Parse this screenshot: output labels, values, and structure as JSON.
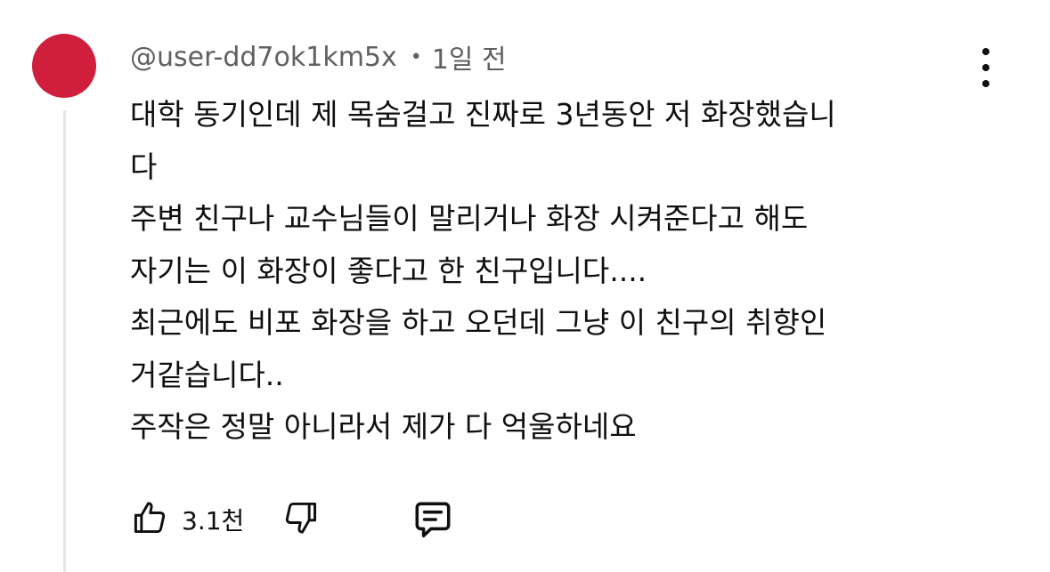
{
  "comment": {
    "author": "@user-dd7ok1km5x",
    "separator": "•",
    "timestamp": "1일 전",
    "avatar_color": "#d01e3d",
    "lines": [
      "대학 동기인데 제 목숨걸고 진짜로 3년동안 저 화장했습니",
      "다",
      "주변 친구나 교수님들이 말리거나 화장 시켜준다고 해도",
      "자기는 이 화장이 좋다고 한 친구입니다....",
      "최근에도 비포 화장을 하고 오던데 그냥 이 친구의 취향인",
      "거같습니다..",
      "주작은 정말 아니라서 제가 다 억울하네요"
    ]
  },
  "actions": {
    "like_icon": "thumbs-up-icon",
    "like_count": "3.1천",
    "dislike_icon": "thumbs-down-icon",
    "reply_icon": "comment-icon"
  },
  "menu": {
    "icon": "more-vert-icon"
  }
}
